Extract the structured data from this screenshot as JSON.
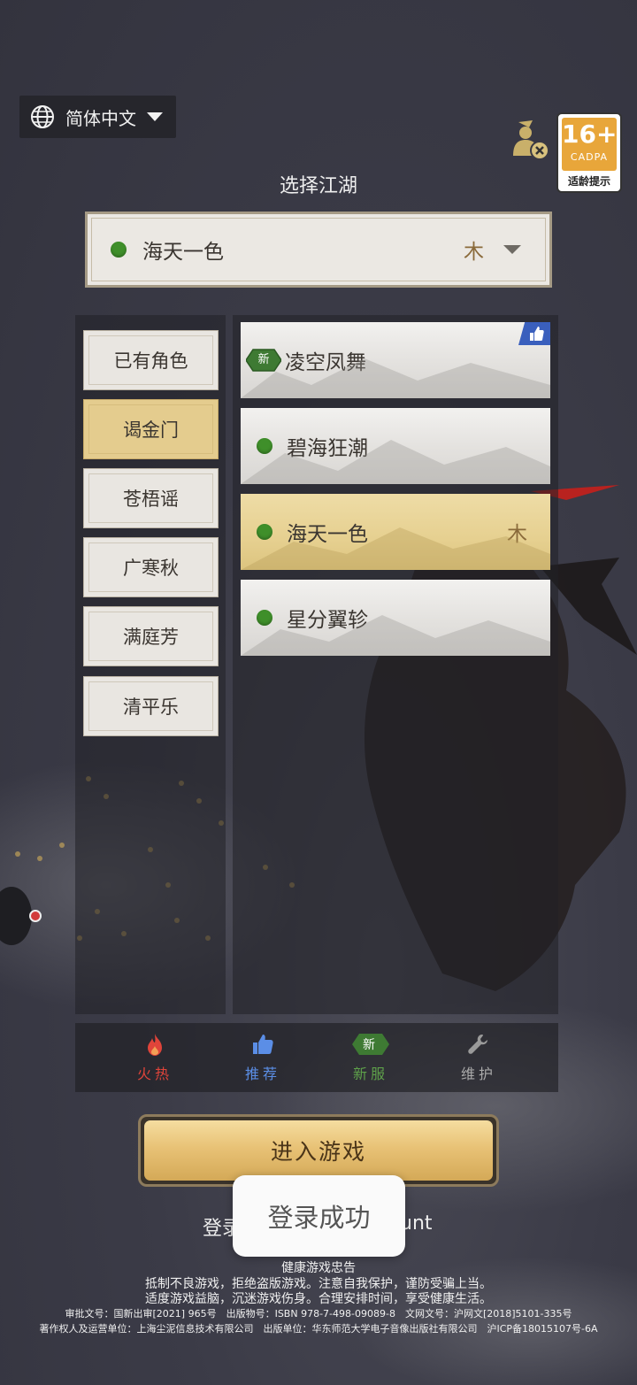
{
  "language": {
    "label": "简体中文"
  },
  "age_rating": {
    "rating": "16+",
    "org": "CADPA",
    "tip": "适龄提示"
  },
  "title": "选择江湖",
  "current_server": {
    "name": "海天一色",
    "tag": "木"
  },
  "categories": [
    {
      "label": "已有角色",
      "selected": false
    },
    {
      "label": "谒金门",
      "selected": true
    },
    {
      "label": "苍梧谣",
      "selected": false
    },
    {
      "label": "广寒秋",
      "selected": false
    },
    {
      "label": "满庭芳",
      "selected": false
    },
    {
      "label": "清平乐",
      "selected": false
    }
  ],
  "servers": [
    {
      "name": "凌空凤舞",
      "new_label": "新",
      "recommended": true,
      "tag": ""
    },
    {
      "name": "碧海狂潮",
      "tag": ""
    },
    {
      "name": "海天一色",
      "tag": "木",
      "selected": true
    },
    {
      "name": "星分翼轸",
      "tag": ""
    }
  ],
  "legend": [
    {
      "label": "火热",
      "color": "#e0443a",
      "icon": "flame-icon"
    },
    {
      "label": "推荐",
      "color": "#5b8ee6",
      "icon": "thumbs-up-icon"
    },
    {
      "label": "新服",
      "color": "#5ea04a",
      "icon": "new-badge-icon",
      "badge_text": "新"
    },
    {
      "label": "维护",
      "color": "#9a9a9a",
      "icon": "wrench-icon"
    }
  ],
  "enter_button": "进入游戏",
  "login_line": {
    "left": "登录",
    "right": "unt"
  },
  "toast": "登录成功",
  "footer": {
    "line1": "健康游戏忠告",
    "line2": "抵制不良游戏，拒绝盗版游戏。注意自我保护，谨防受骗上当。",
    "line3": "适度游戏益脑，沉迷游戏伤身。合理安排时间，享受健康生活。",
    "line4": "审批文号：国新出审[2021] 965号　出版物号：ISBN 978-7-498-09089-8　文网文号：沪网文[2018]5101-335号",
    "line5": "著作权人及运营单位：上海尘泥信息技术有限公司　出版单位：华东师范大学电子音像出版社有限公司　沪ICP备18015107号-6A"
  }
}
